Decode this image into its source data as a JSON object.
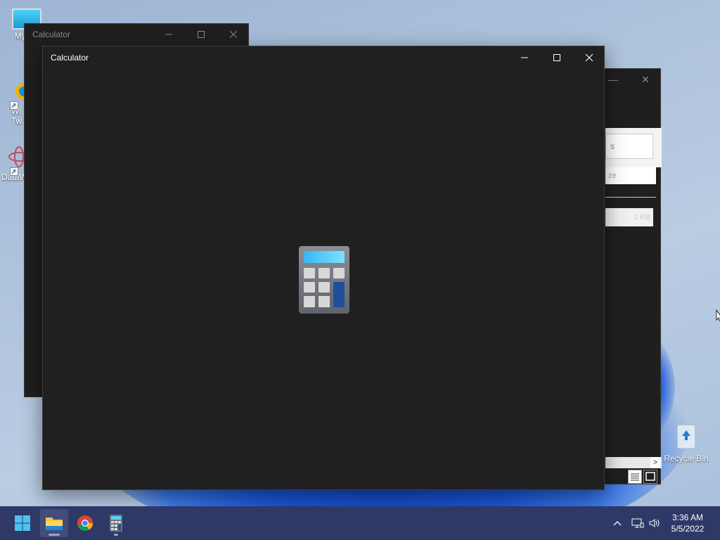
{
  "desktop": {
    "icons": [
      {
        "label": "My Co",
        "icon": "computer-icon"
      },
      {
        "label": "Wi Tw",
        "icon": "app-shortcut-icon"
      },
      {
        "label": "DataW",
        "icon": "app-shortcut-icon"
      },
      {
        "label": "Recycle Bin",
        "icon": "recycle-bin-icon"
      }
    ]
  },
  "back_window": {
    "title": "Calculator",
    "controls": [
      "minimize",
      "maximize",
      "close"
    ]
  },
  "explorer_window": {
    "fragments": [
      "s",
      "ze",
      "1 KB"
    ],
    "scroll_arrow": ">"
  },
  "calculator_window": {
    "title": "Calculator",
    "controls": {
      "minimize": "minimize-icon",
      "maximize": "maximize-icon",
      "close": "close-icon"
    },
    "splash_icon": "calculator-icon"
  },
  "taskbar": {
    "apps": [
      {
        "name": "Start",
        "icon": "windows-start-icon"
      },
      {
        "name": "File Explorer",
        "icon": "folder-icon"
      },
      {
        "name": "Google Chrome",
        "icon": "chrome-icon"
      },
      {
        "name": "Calculator",
        "icon": "calculator-icon"
      }
    ],
    "tray": {
      "show_hidden": "chevron-up-icon",
      "network": "network-icon",
      "volume": "volume-icon"
    },
    "clock": {
      "time": "3:36 AM",
      "date": "5/5/2022"
    }
  },
  "colors": {
    "window_bg": "#202020",
    "taskbar_bg": "#2e3968",
    "accent": "#4cc2f0"
  }
}
